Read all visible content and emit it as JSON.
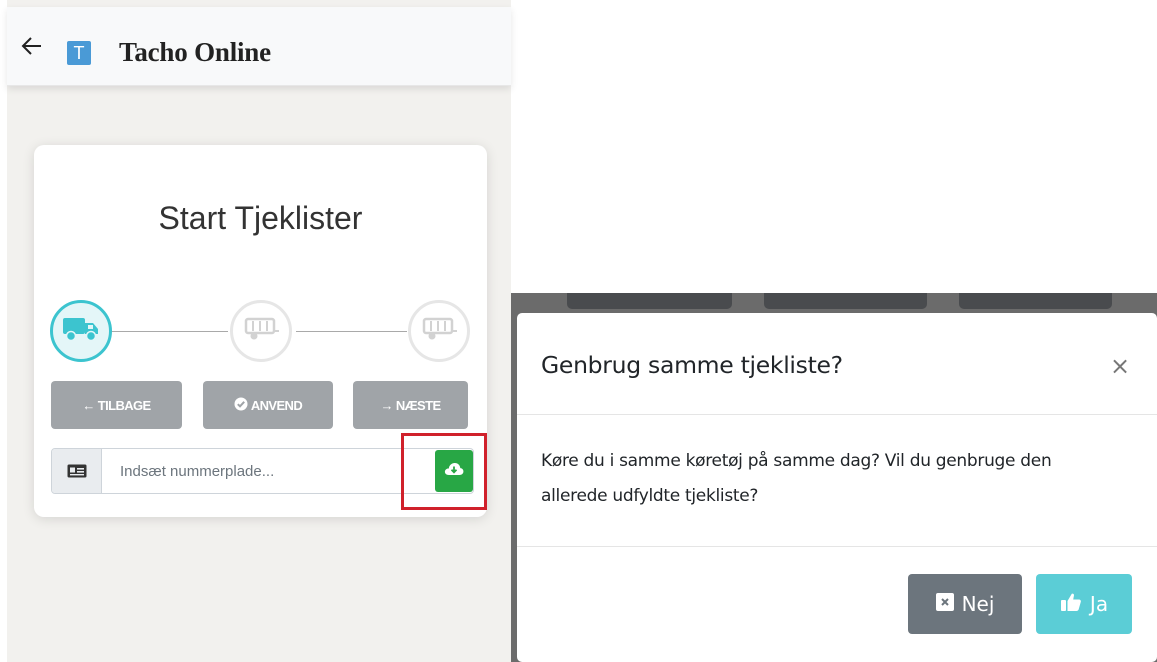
{
  "app": {
    "title": "Tacho Online",
    "logo_letter": "T"
  },
  "checklist_card": {
    "title": "Start Tjeklister",
    "steps": [
      {
        "icon": "truck-icon",
        "state": "active"
      },
      {
        "icon": "trailer-icon",
        "state": "inactive"
      },
      {
        "icon": "trailer-icon",
        "state": "inactive"
      }
    ],
    "buttons": {
      "back": "TILBAGE",
      "apply": "ANVEND",
      "next": "NÆSTE"
    },
    "plate_input": {
      "placeholder": "Indsæt nummerplade...",
      "value": ""
    }
  },
  "modal": {
    "title": "Genbrug samme tjekliste?",
    "close": "×",
    "body": "Køre du i samme køretøj på samme dag? Vil du genbruge den allerede udfyldte tjekliste?",
    "buttons": {
      "no": "Nej",
      "yes": "Ja"
    }
  },
  "colors": {
    "accent_teal": "#3cc4cf",
    "success_green": "#28a745",
    "secondary_gray": "#6c757d",
    "info_cyan": "#5bcdd6",
    "highlight_red": "#d0212b"
  }
}
